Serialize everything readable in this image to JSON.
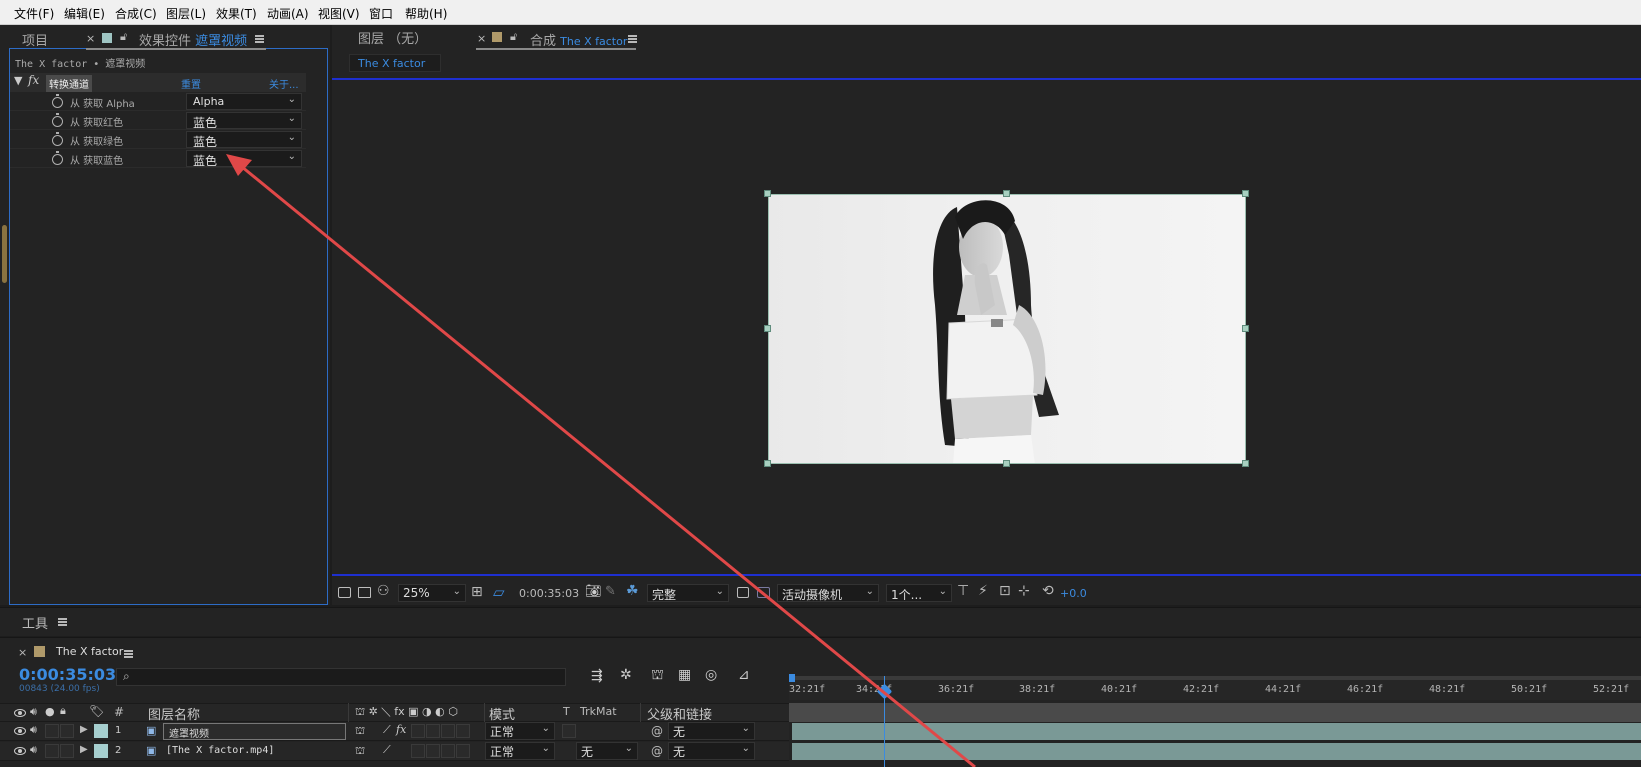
{
  "menu": {
    "items": [
      "文件(F)",
      "编辑(E)",
      "合成(C)",
      "图层(L)",
      "效果(T)",
      "动画(A)",
      "视图(V)",
      "窗口",
      "帮助(H)"
    ]
  },
  "left_panel": {
    "tab_project": "项目",
    "tab_effects_prefix": "效果控件",
    "tab_effects_layer": "遮罩视频",
    "breadcrumb": "The X factor • 遮罩视频",
    "effect_name": "转换通道",
    "reset_label": "重置",
    "about_label": "关于...",
    "properties": [
      {
        "label": "从 获取 Alpha",
        "value": "Alpha"
      },
      {
        "label": "从 获取红色",
        "value": "蓝色"
      },
      {
        "label": "从 获取绿色",
        "value": "蓝色"
      },
      {
        "label": "从 获取蓝色",
        "value": "蓝色"
      }
    ]
  },
  "viewer": {
    "tab_layer": "图层 （无）",
    "tab_comp_prefix": "合成",
    "tab_comp_name": "The X factor",
    "comp_sub_tab": "The X factor",
    "zoom": "25%",
    "timecode": "0:00:35:03",
    "resolution": "完整",
    "camera": "活动摄像机",
    "views": "1个...",
    "exposure": "+0.0"
  },
  "tools_panel": {
    "label": "工具"
  },
  "timeline": {
    "comp_tab": "The X factor",
    "timecode": "0:00:35:03",
    "frame_info": "00843 (24.00 fps)",
    "search_placeholder": "",
    "ruler_labels": [
      "32:21f",
      "34:21f",
      "36:21f",
      "38:21f",
      "40:21f",
      "42:21f",
      "44:21f",
      "46:21f",
      "48:21f",
      "50:21f",
      "52:21f"
    ],
    "columns": {
      "number": "#",
      "layer_name": "图层名称",
      "mode": "模式",
      "t": "T",
      "trkmat": "TrkMat",
      "parent": "父级和链接"
    },
    "layers": [
      {
        "index": "1",
        "name": "遮罩视频",
        "mode": "正常",
        "trkmat": "",
        "parent": "无"
      },
      {
        "index": "2",
        "name": "[The X factor.mp4]",
        "mode": "正常",
        "trkmat": "无",
        "parent": "无"
      }
    ]
  },
  "colors": {
    "accent_blue": "#3b8be0",
    "annotation_arrow": "#e04848",
    "layer_bar": "#7a9996"
  }
}
